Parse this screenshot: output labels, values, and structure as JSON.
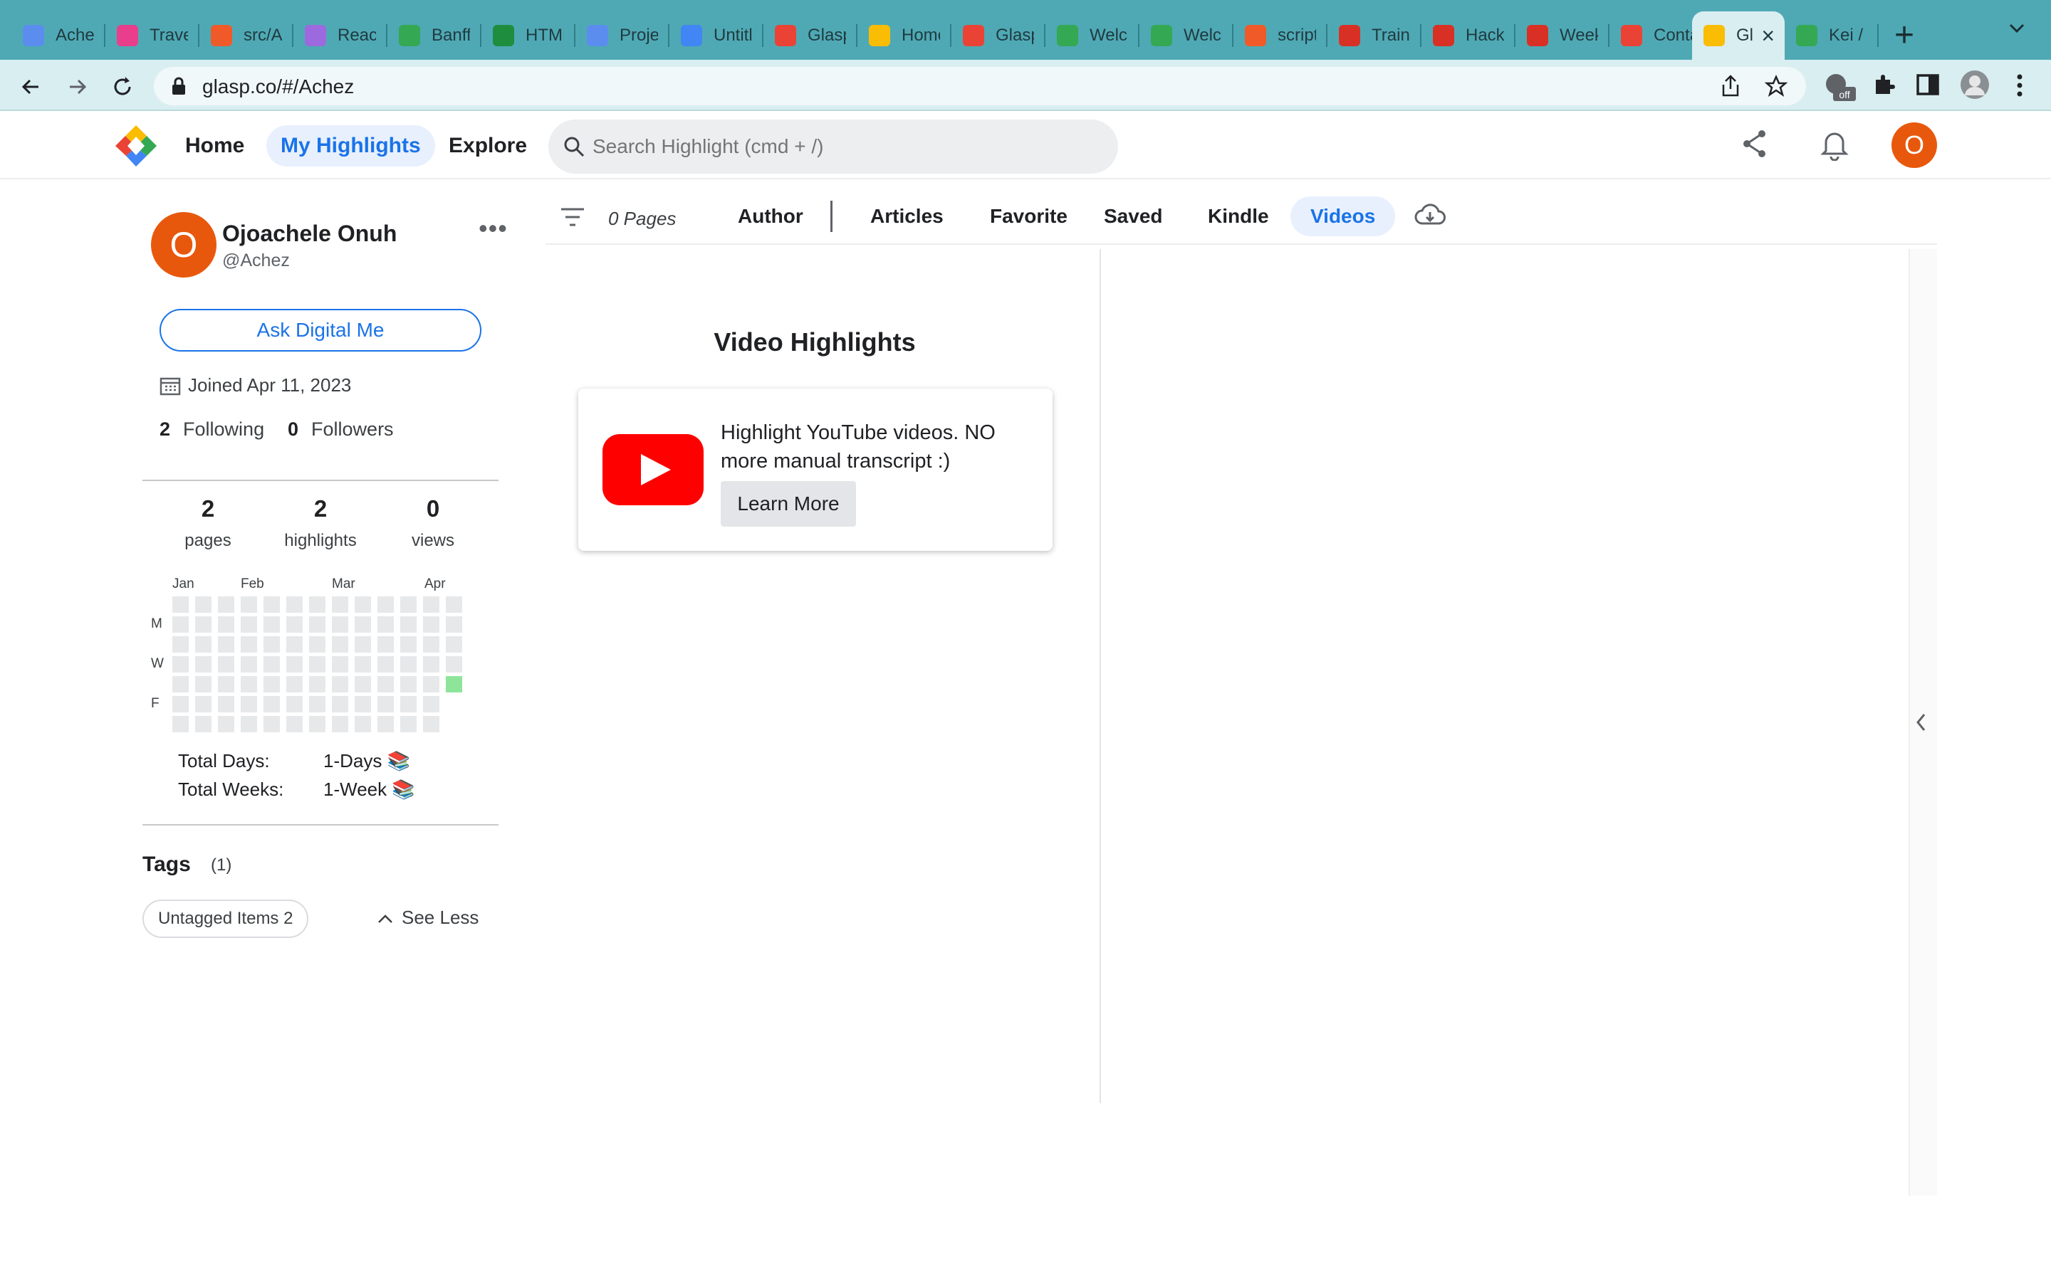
{
  "browser": {
    "tabs": [
      {
        "title": "Acher",
        "color": "#5b8def"
      },
      {
        "title": "Travel",
        "color": "#e83e8c"
      },
      {
        "title": "src/App",
        "color": "#f05a28"
      },
      {
        "title": "React",
        "color": "#9c6ade"
      },
      {
        "title": "Banff",
        "color": "#34a853"
      },
      {
        "title": "HTML",
        "color": "#1e8e3e"
      },
      {
        "title": "Project",
        "color": "#5b8def"
      },
      {
        "title": "Untitled",
        "color": "#4285f4"
      },
      {
        "title": "Glasp",
        "color": "#ea4335"
      },
      {
        "title": "Home",
        "color": "#fbbc04"
      },
      {
        "title": "Glasp",
        "color": "#ea4335"
      },
      {
        "title": "Welcome",
        "color": "#34a853"
      },
      {
        "title": "Welcome",
        "color": "#34a853"
      },
      {
        "title": "script",
        "color": "#f05a28"
      },
      {
        "title": "Train",
        "color": "#d93025"
      },
      {
        "title": "Hack",
        "color": "#d93025"
      },
      {
        "title": "Week",
        "color": "#d93025"
      },
      {
        "title": "Contact",
        "color": "#ea4335"
      },
      {
        "title": "Glasp",
        "color": "#fbbc04",
        "active": true
      },
      {
        "title": "Kei /",
        "color": "#34a853"
      }
    ],
    "url": "glasp.co/#/Achez",
    "extension_badge": "off"
  },
  "header": {
    "nav": [
      "Home",
      "My Highlights",
      "Explore"
    ],
    "active_nav": "My Highlights",
    "search_placeholder": "Search Highlight (cmd + /)",
    "user_initial": "O"
  },
  "profile": {
    "initial": "O",
    "name": "Ojoachele Onuh",
    "handle": "@Achez",
    "ask_button": "Ask Digital Me",
    "joined": "Joined Apr 11, 2023",
    "following_count": "2",
    "following_label": "Following",
    "followers_count": "0",
    "followers_label": "Followers",
    "stats": [
      {
        "value": "2",
        "label": "pages"
      },
      {
        "value": "2",
        "label": "highlights"
      },
      {
        "value": "0",
        "label": "views"
      }
    ],
    "heatmap": {
      "months": [
        "Jan",
        "Feb",
        "Mar",
        "Apr"
      ],
      "days": [
        "M",
        "W",
        "F"
      ],
      "weeks": 13,
      "active_cells": [
        {
          "week": 12,
          "day": 4
        }
      ]
    },
    "total_days_label": "Total Days:",
    "total_days_value": "1-Days 📚",
    "total_weeks_label": "Total Weeks:",
    "total_weeks_value": "1-Week 📚",
    "tags_title": "Tags",
    "tags_count": "(1)",
    "tag_chip": "Untagged Items 2",
    "see_less": "See Less"
  },
  "filters": {
    "pages_count": "0 Pages",
    "tabs": [
      "Author",
      "Articles",
      "Favorite",
      "Saved",
      "Kindle",
      "Videos"
    ],
    "active_tab": "Videos"
  },
  "main": {
    "title": "Video Highlights",
    "card_text": "Highlight YouTube videos. NO more manual transcript :)",
    "learn_more": "Learn More"
  },
  "colors": {
    "accent": "#1a73e8",
    "avatar": "#e8580c",
    "youtube": "#ff0000",
    "heat_on": "#8ee59a",
    "tabbar": "#4fa9b4"
  }
}
